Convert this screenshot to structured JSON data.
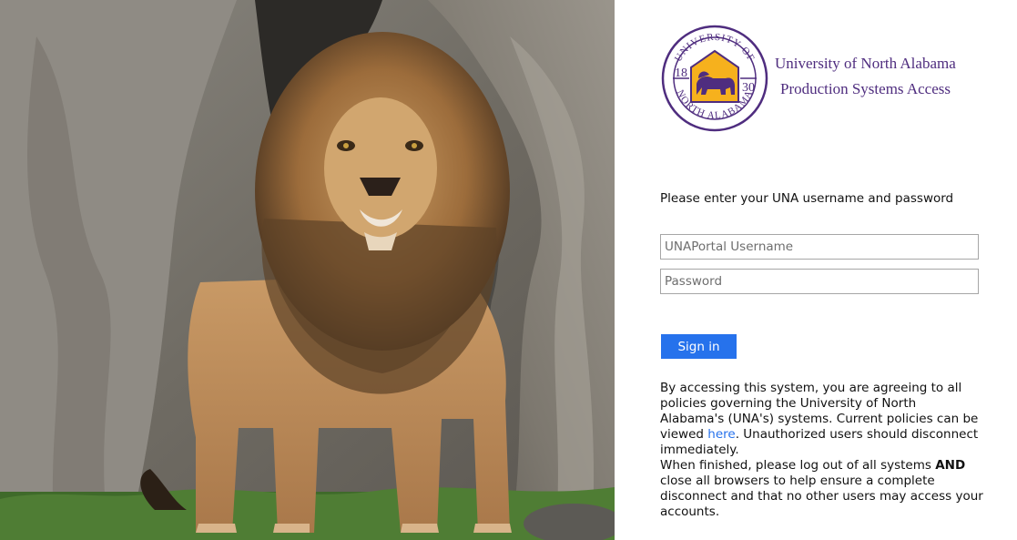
{
  "brand": {
    "title_line1": "University of North Alabama",
    "title_line2": "Production Systems Access",
    "seal_top": "UNIVERSITY OF",
    "seal_bottom": "NORTH ALABAMA",
    "seal_year_left": "18",
    "seal_year_right": "30",
    "purple": "#4f2d7f",
    "gold": "#f6b11d"
  },
  "illustration": {
    "subject": "lion-standing-on-rock-ledge"
  },
  "form": {
    "prompt": "Please enter your UNA username and password",
    "username_placeholder": "UNAPortal Username",
    "username_value": "",
    "password_placeholder": "Password",
    "password_value": "",
    "signin_label": "Sign in",
    "accent": "#2672ec"
  },
  "notice": {
    "p1_before": "By accessing this system, you are agreeing to all policies governing the University of North Alabama's (UNA's) systems. Current policies can be viewed ",
    "p1_link": "here",
    "p1_after": ". Unauthorized users should disconnect immediately.",
    "p2_before": "When finished, please log out of all systems ",
    "p2_bold": "AND",
    "p2_after": " close all browsers to help ensure a complete disconnect and that no other users may access your accounts."
  }
}
